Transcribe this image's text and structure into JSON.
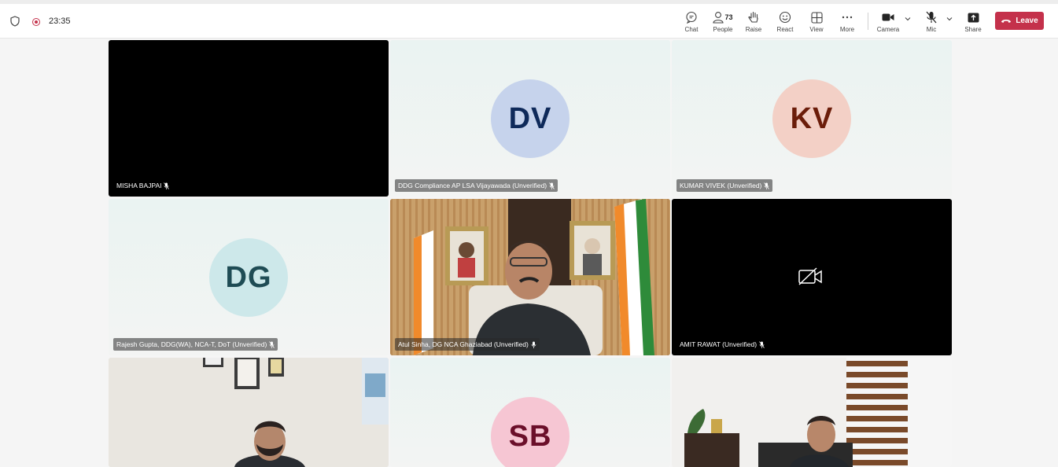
{
  "topbar": {
    "timer": "23:35",
    "buttons": {
      "chat": "Chat",
      "people": "People",
      "people_count": "73",
      "raise": "Raise",
      "react": "React",
      "view": "View",
      "more": "More",
      "camera": "Camera",
      "mic": "Mic",
      "share": "Share",
      "leave": "Leave"
    }
  },
  "participants": [
    {
      "name": "MISHA BAJPAI",
      "initials": "",
      "muted": true
    },
    {
      "name": "DDG Compliance AP LSA Vijayawada (Unverified)",
      "initials": "DV",
      "muted": true
    },
    {
      "name": "KUMAR VIVEK (Unverified)",
      "initials": "KV",
      "muted": true
    },
    {
      "name": "Rajesh Gupta, DDG(WA), NCA-T, DoT (Unverified)",
      "initials": "DG",
      "muted": true
    },
    {
      "name": "Atul Sinha, DG NCA Ghaziabad (Unverified)",
      "initials": "",
      "muted": false
    },
    {
      "name": "AMIT RAWAT (Unverified)",
      "initials": "",
      "muted": true
    },
    {
      "name": "",
      "initials": "",
      "muted": false
    },
    {
      "name": "",
      "initials": "SB",
      "muted": false
    },
    {
      "name": "",
      "initials": "",
      "muted": false
    }
  ],
  "colors": {
    "leave": "#c4314b",
    "dv_bg": "#c6d3ec",
    "dv_fg": "#0f2a5a",
    "kv_bg": "#f3d0c6",
    "kv_fg": "#6b1d0a",
    "dg_bg": "#cde8ea",
    "dg_fg": "#1f4c55",
    "sb_bg": "#f6c6d3",
    "sb_fg": "#6b0f2a"
  }
}
